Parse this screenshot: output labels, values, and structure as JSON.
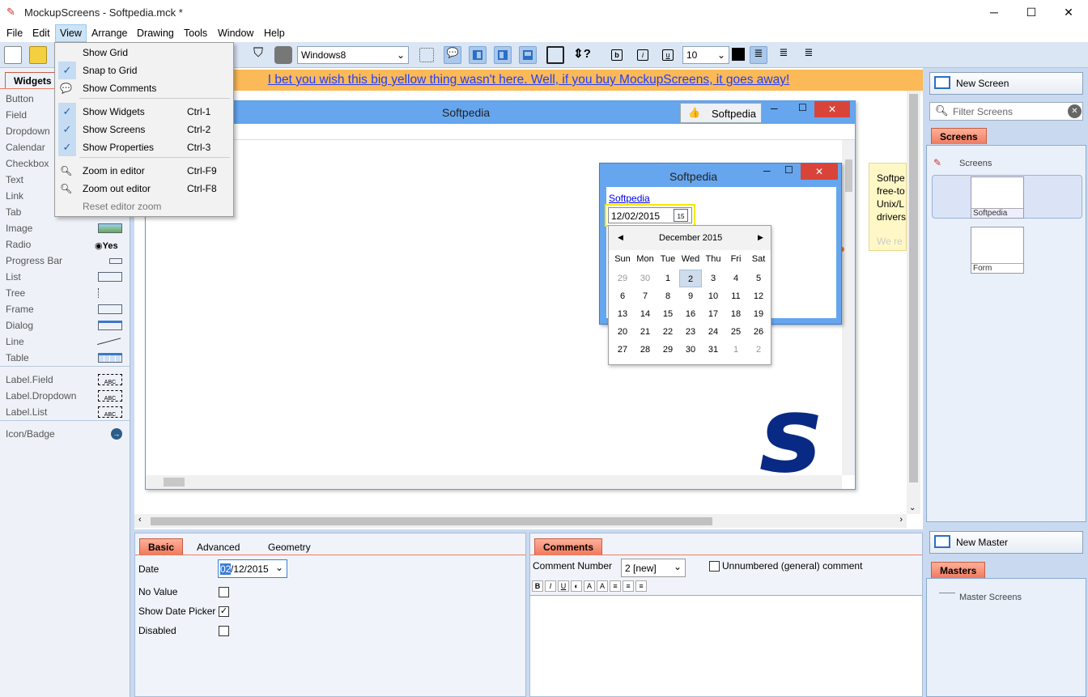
{
  "window": {
    "title": "MockupScreens - Softpedia.mck *",
    "min": "─",
    "max": "☐",
    "close": "✕"
  },
  "menubar": [
    "File",
    "Edit",
    "View",
    "Arrange",
    "Drawing",
    "Tools",
    "Window",
    "Help"
  ],
  "toolbar": {
    "theme_select": "Windows8",
    "font_size": "10",
    "font_color": "#000000"
  },
  "view_menu": {
    "items": [
      {
        "label": "Show Grid",
        "shortcut": "",
        "checked": false
      },
      {
        "label": "Snap to Grid",
        "shortcut": "",
        "checked": true
      },
      {
        "label": "Show Comments",
        "shortcut": "",
        "checked": false
      },
      {
        "label": "Show Widgets",
        "shortcut": "Ctrl-1",
        "checked": true
      },
      {
        "label": "Show Screens",
        "shortcut": "Ctrl-2",
        "checked": true
      },
      {
        "label": "Show Properties",
        "shortcut": "Ctrl-3",
        "checked": true
      },
      {
        "label": "Zoom in editor",
        "shortcut": "Ctrl-F9",
        "checked": false
      },
      {
        "label": "Zoom out editor",
        "shortcut": "Ctrl-F8",
        "checked": false
      },
      {
        "label": "Reset editor zoom",
        "shortcut": "",
        "checked": false
      }
    ]
  },
  "widgets": {
    "tab": "Widgets",
    "items": [
      "Button",
      "Field",
      "Dropdown",
      "Calendar",
      "Checkbox",
      "Text",
      "Link",
      "Tab",
      "Image",
      "Radio",
      "Progress Bar",
      "List",
      "Tree",
      "Frame",
      "Dialog",
      "Line",
      "Table",
      "Label.Field",
      "Label.Dropdown",
      "Label.List",
      "Icon/Badge"
    ],
    "radio_sample": "Yes",
    "label_sample": "ABC"
  },
  "banner": {
    "text": "I bet you wish this big yellow thing wasn't here. Well, if you buy MockupScreens, it goes away!"
  },
  "mockup": {
    "main_title": "Softpedia",
    "like_button": "Softpedia",
    "dialog_title": "Softpedia",
    "dialog_link": "Softpedia",
    "date_value": "12/02/2015",
    "calendar": {
      "month": "December 2015",
      "weekdays": [
        "Sun",
        "Mon",
        "Tue",
        "Wed",
        "Thu",
        "Fri",
        "Sat"
      ],
      "weeks": [
        [
          "29",
          "30",
          "1",
          "2",
          "3",
          "4",
          "5"
        ],
        [
          "6",
          "7",
          "8",
          "9",
          "10",
          "11",
          "12"
        ],
        [
          "13",
          "14",
          "15",
          "16",
          "17",
          "18",
          "19"
        ],
        [
          "20",
          "21",
          "22",
          "23",
          "24",
          "25",
          "26"
        ],
        [
          "27",
          "28",
          "29",
          "30",
          "31",
          "1",
          "2"
        ]
      ],
      "selected": "2"
    },
    "note_lines": [
      "Softpe",
      "free-to",
      "Unix/L",
      "drivers",
      "We re"
    ]
  },
  "properties": {
    "tabs": [
      "Basic",
      "Advanced",
      "Geometry"
    ],
    "date_label": "Date",
    "date_value_sel": "02",
    "date_value_rest": "/12/2015",
    "rows": [
      {
        "label": "No Value",
        "checked": false
      },
      {
        "label": "Show Date Picker",
        "checked": true
      },
      {
        "label": "Disabled",
        "checked": false
      }
    ]
  },
  "comments": {
    "tab": "Comments",
    "number_label": "Comment Number",
    "number_value": "2  [new]",
    "unnumbered_label": "Unnumbered (general) comment",
    "format_buttons": [
      "B",
      "I",
      "U",
      "◐",
      "A",
      "A",
      "≡",
      "≡",
      "≡"
    ]
  },
  "screens": {
    "new_screen": "New Screen",
    "filter_placeholder": "Filter Screens",
    "tab": "Screens",
    "root": "Screens",
    "items": [
      "Softpedia",
      "Form"
    ],
    "new_master": "New Master",
    "masters_tab": "Masters",
    "master_root": "Master Screens"
  }
}
